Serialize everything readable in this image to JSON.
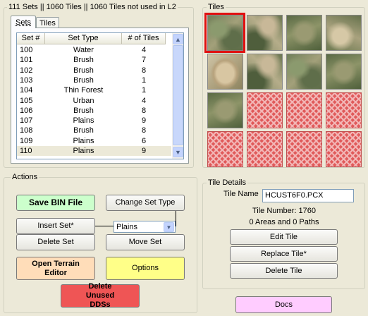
{
  "header": {
    "status": "111 Sets || 1060 Tiles || 1060 Tiles not used in L2"
  },
  "tabs": [
    "Sets",
    "Tiles"
  ],
  "sets_table": {
    "columns": [
      "Set #",
      "Set Type",
      "# of Tiles"
    ],
    "rows": [
      [
        "100",
        "Water",
        "4"
      ],
      [
        "101",
        "Brush",
        "7"
      ],
      [
        "102",
        "Brush",
        "8"
      ],
      [
        "103",
        "Brush",
        "1"
      ],
      [
        "104",
        "Thin Forest",
        "1"
      ],
      [
        "105",
        "Urban",
        "4"
      ],
      [
        "106",
        "Brush",
        "8"
      ],
      [
        "107",
        "Plains",
        "9"
      ],
      [
        "108",
        "Brush",
        "8"
      ],
      [
        "109",
        "Plains",
        "6"
      ],
      [
        "110",
        "Plains",
        "9"
      ]
    ],
    "selected_row": "110"
  },
  "tiles_panel": {
    "title": "Tiles",
    "grid": [
      [
        "terrain1",
        "terrain2",
        "terrain3",
        "terrain4"
      ],
      [
        "water",
        "terrain2",
        "terrain1",
        "terrain3"
      ],
      [
        "terrain3",
        "red",
        "red",
        "red"
      ],
      [
        "red",
        "red",
        "red",
        "red"
      ]
    ],
    "selected_tile": "row 1, column 1"
  },
  "actions": {
    "title": "Actions",
    "save_bin": "Save BIN File",
    "change_set_type": "Change Set Type",
    "insert_set": "Insert Set*",
    "set_type_select": "Plains",
    "delete_set": "Delete Set",
    "move_set": "Move Set",
    "open_terrain_editor": "Open Terrain Editor",
    "options": "Options",
    "delete_unused": "Delete Unused DDSs"
  },
  "tile_details": {
    "title": "Tile Details",
    "tile_name_label": "Tile Name",
    "tile_name_value": "HCUST6F0.PCX",
    "tile_number": "Tile Number: 1760",
    "areas_paths": "0 Areas and 0 Paths",
    "edit_tile": "Edit Tile",
    "replace_tile": "Replace Tile*",
    "delete_tile": "Delete Tile"
  },
  "docs": "Docs",
  "colors": {
    "window_bg": "#ece9d8",
    "save_bin": "#ccffcc",
    "open_terrain_editor": "#ffddb9",
    "options": "#ffff88",
    "delete_unused": "#ef5555",
    "docs": "#ffccff",
    "tile_selection": "#e01010"
  }
}
